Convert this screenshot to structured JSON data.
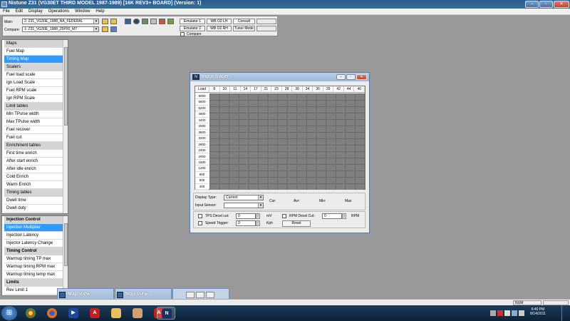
{
  "window": {
    "title": "Nistune Z31 (VG30ET THIRD MODEL 1987-1989) [16K REV3+ BOARD] (Version: 1)",
    "min_glyph": "–",
    "max_glyph": "▫",
    "close_glyph": "✕"
  },
  "menu": [
    "File",
    "Edit",
    "Display",
    "Operations",
    "Window",
    "Help"
  ],
  "toolbar": {
    "main_label": "Main:",
    "main_value": "2: Z31_VG30E_1988_NA_FEDERAL",
    "compare_label": "Compare:",
    "compare_value": "1: Z31_VG30E_1988_25P00_M7",
    "emulator1": "Emulator 1",
    "emulator2": "Emulator 2",
    "wb_o2_lh": "WB O2 LH",
    "wb_o2_rh": "WB O2 RH",
    "consult": "Consult",
    "tuner_mode": "Tuner Mode",
    "compare_checkbox": "Compare"
  },
  "sidebar_top": [
    {
      "label": "Maps",
      "type": "header"
    },
    {
      "label": "Fuel Map",
      "type": "item"
    },
    {
      "label": "Timing Map",
      "type": "selected"
    },
    {
      "label": "Scalers",
      "type": "header"
    },
    {
      "label": "Fuel load scale",
      "type": "item"
    },
    {
      "label": "Ign Load Scale",
      "type": "item"
    },
    {
      "label": "Fuel RPM scale",
      "type": "item"
    },
    {
      "label": "Ign RPM Scale",
      "type": "item"
    },
    {
      "label": "Limit tables",
      "type": "header"
    },
    {
      "label": "Min TPulse width",
      "type": "item"
    },
    {
      "label": "Max TPulse width",
      "type": "item"
    },
    {
      "label": "Fuel recover",
      "type": "item"
    },
    {
      "label": "Fuel cut",
      "type": "item"
    },
    {
      "label": "Enrichment tables",
      "type": "header"
    },
    {
      "label": "First time enrich",
      "type": "item"
    },
    {
      "label": "After start enrich",
      "type": "item"
    },
    {
      "label": "After idle enrich",
      "type": "item"
    },
    {
      "label": "Cold Enrich",
      "type": "item"
    },
    {
      "label": "Warm Enrich",
      "type": "item"
    },
    {
      "label": "Timing tables",
      "type": "header"
    },
    {
      "label": "Dwell time",
      "type": "item"
    },
    {
      "label": "Dwell duty",
      "type": "item"
    }
  ],
  "sidebar_bottom": [
    {
      "label": "Injection Control",
      "type": "bold-header"
    },
    {
      "label": "Injection Multiplier",
      "type": "selected"
    },
    {
      "label": "Injection Latency",
      "type": "item"
    },
    {
      "label": "Injector Latency Change",
      "type": "item"
    },
    {
      "label": "Timing Control",
      "type": "bold-header"
    },
    {
      "label": "Warmup timing TP max",
      "type": "item"
    },
    {
      "label": "Warmup timing RPM max",
      "type": "item"
    },
    {
      "label": "Warmup timing temp max",
      "type": "item"
    },
    {
      "label": "Limits",
      "type": "bold-header"
    },
    {
      "label": "Rev Limit 1",
      "type": "item"
    }
  ],
  "tracer": {
    "title": "Input tracer",
    "corner_label": "Load",
    "columns": [
      "8",
      "10",
      "11",
      "14",
      "17",
      "21",
      "23",
      "28",
      "30",
      "34",
      "36",
      "39",
      "42",
      "44",
      "46"
    ],
    "rows": [
      "6000",
      "5600",
      "5200",
      "4800",
      "4400",
      "4000",
      "3600",
      "3200",
      "2800",
      "2400",
      "2000",
      "1600",
      "1200",
      "800",
      "500",
      "400"
    ],
    "display_type_label": "Display Type:",
    "display_type_value": "Current",
    "input_sensor_label": "Input Sensor:",
    "input_sensor_value": "",
    "cur_label": "Cur:",
    "avr_label": "Avr:",
    "min_label": "Min:",
    "max_label": "Max",
    "tps_decel_label": "TPS Decel cut:",
    "tps_decel_value": "0",
    "tps_unit": "mV",
    "rpm_decel_label": "RPM Decel Cut:",
    "rpm_decel_value": "0",
    "rpm_unit": "RPM",
    "speed_trigger_label": "Speed Trigger:",
    "speed_trigger_value": "0",
    "speed_unit": "Kph",
    "reset_label": "Reset"
  },
  "minimized": [
    {
      "title": "Map View"
    },
    {
      "title": "Map View"
    }
  ],
  "statusbar": {
    "num": "NUM"
  },
  "taskbar": {
    "start": "⊞",
    "time": "6:40 PM",
    "date": "8/14/2011"
  }
}
